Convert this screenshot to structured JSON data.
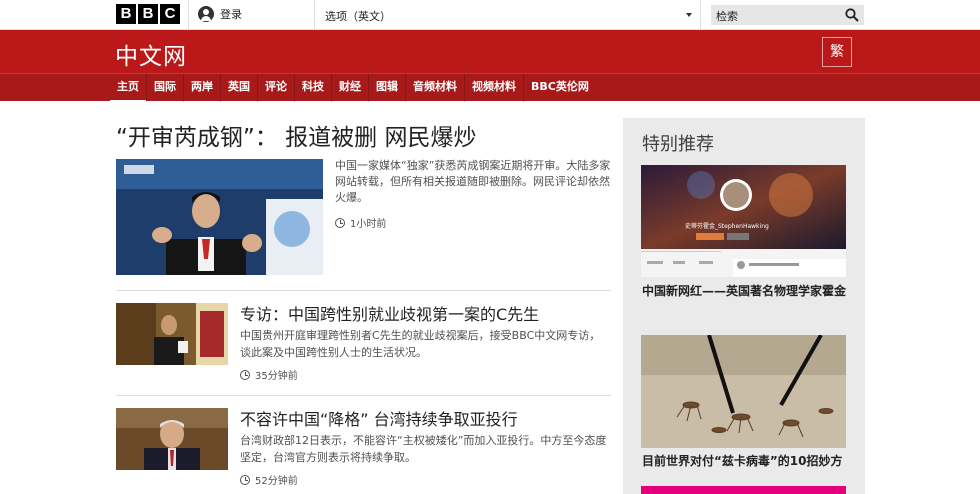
{
  "topbar": {
    "logo_letters": [
      "B",
      "B",
      "C"
    ],
    "signin_label": "登录",
    "options_label": "选项（英文）",
    "search_placeholder": "检索"
  },
  "header": {
    "site_title": "中文网",
    "traditional_button": "繁"
  },
  "nav": {
    "items": [
      {
        "label": "主页"
      },
      {
        "label": "国际"
      },
      {
        "label": "两岸"
      },
      {
        "label": "英国"
      },
      {
        "label": "评论"
      },
      {
        "label": "科技"
      },
      {
        "label": "财经"
      },
      {
        "label": "图辑"
      },
      {
        "label": "音频材料"
      },
      {
        "label": "视频材料"
      },
      {
        "label": "BBC英伦网"
      }
    ]
  },
  "lead": {
    "title": "“开审芮成钢”： 报道被删 网民爆炒",
    "summary": "中国一家媒体“独家”获悉芮成钢案近期将开审。大陆多家网站转载，但所有相关报道随即被删除。网民评论却依然火爆。",
    "time": "1小时前"
  },
  "stories": [
    {
      "title": "专访：中国跨性别就业歧视第一案的C先生",
      "summary": "中国贵州开庭审理跨性别者C先生的就业歧视案后，接受BBC中文网专访，谈此案及中国跨性别人士的生活状况。",
      "time": "35分钟前"
    },
    {
      "title": "不容许中国“降格” 台湾持续争取亚投行",
      "summary": "台湾财政部12日表示，不能容许“主权被矮化”而加入亚投行。中方至今态度坚定，台湾官方则表示将持续争取。",
      "time": "52分钟前"
    }
  ],
  "sidebar": {
    "heading": "特别推荐",
    "items": [
      {
        "caption": "中国新网红——英国著名物理学家霍金",
        "image_text": "史蒂芬霍金_StephenHawking"
      },
      {
        "caption": "目前世界对付“兹卡病毒”的10招妙方"
      }
    ]
  },
  "colors": {
    "brand_red": "#bb1919",
    "nav_red": "#a81a1a",
    "sidebar_bg": "#eaeaea",
    "accent_pink": "#e4007b"
  }
}
